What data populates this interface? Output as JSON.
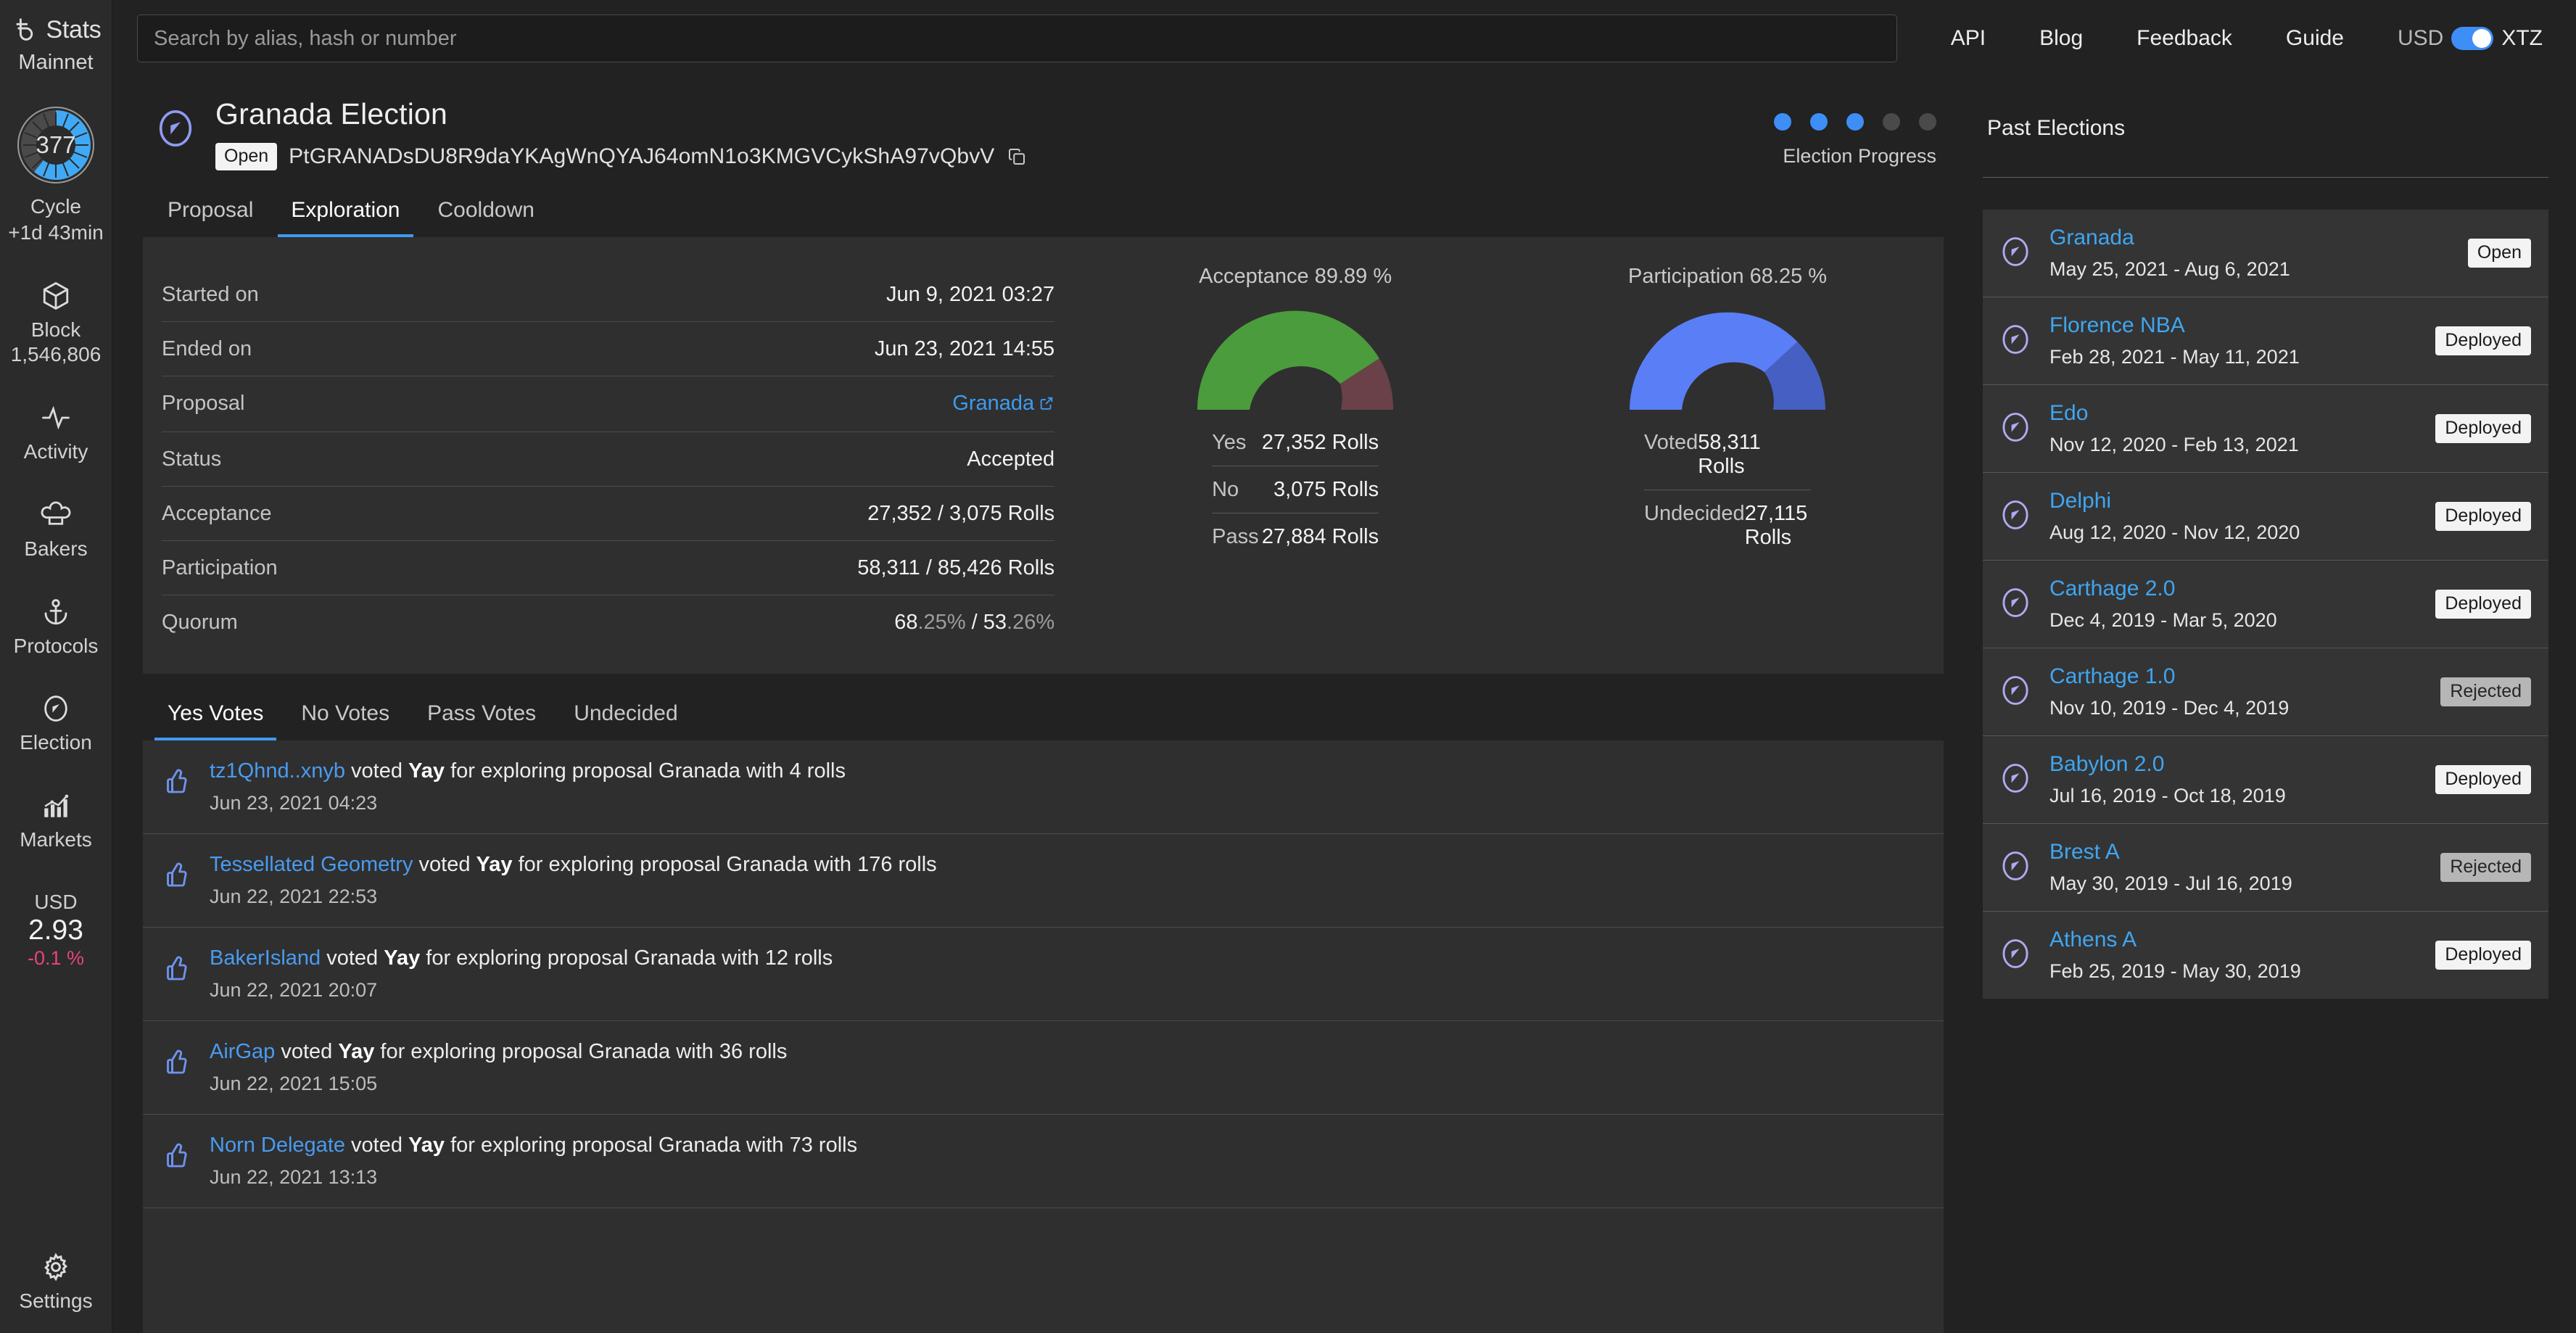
{
  "sidebar": {
    "brand": "Stats",
    "network": "Mainnet",
    "cycle": {
      "number": "377",
      "label": "Cycle",
      "eta": "+1d 43min"
    },
    "items": [
      {
        "icon": "cube-icon",
        "label": "Block",
        "sub": "1,546,806"
      },
      {
        "icon": "activity-icon",
        "label": "Activity",
        "sub": ""
      },
      {
        "icon": "chef-hat-icon",
        "label": "Bakers",
        "sub": ""
      },
      {
        "icon": "anchor-icon",
        "label": "Protocols",
        "sub": ""
      },
      {
        "icon": "compass-icon",
        "label": "Election",
        "sub": ""
      },
      {
        "icon": "bar-chart-icon",
        "label": "Markets",
        "sub": ""
      }
    ],
    "price": {
      "currency": "USD",
      "value": "2.93",
      "change": "-0.1 %"
    },
    "settings": {
      "icon": "gear-icon",
      "label": "Settings"
    }
  },
  "topbar": {
    "search_placeholder": "Search by alias, hash or number",
    "search_value": "",
    "links": [
      "API",
      "Blog",
      "Feedback",
      "Guide"
    ],
    "currency_toggle": {
      "left": "USD",
      "right": "XTZ",
      "on": true
    }
  },
  "election": {
    "title": "Granada Election",
    "status_badge": "Open",
    "hash": "PtGRANADsDU8R9daYKAgWnQYAJ64omN1o3KMGVCykShA97vQbvV",
    "progress": {
      "label": "Election Progress",
      "total": 5,
      "filled": 3
    },
    "tabs": [
      {
        "label": "Proposal",
        "active": false
      },
      {
        "label": "Exploration",
        "active": true
      },
      {
        "label": "Cooldown",
        "active": false
      }
    ],
    "details": [
      {
        "key": "Started on",
        "value": "Jun 9, 2021 03:27"
      },
      {
        "key": "Ended on",
        "value": "Jun 23, 2021 14:55"
      },
      {
        "key": "Proposal",
        "value": "Granada",
        "link": true
      },
      {
        "key": "Status",
        "value": "Accepted"
      },
      {
        "key": "Acceptance",
        "value": "27,352 / 3,075 Rolls"
      },
      {
        "key": "Participation",
        "value": "58,311 / 85,426 Rolls"
      },
      {
        "key": "Quorum",
        "value_main": "68",
        "value_dim": ".25%",
        "value_main2": " / 53",
        "value_dim2": ".26%"
      }
    ]
  },
  "chart_data": [
    {
      "type": "pie",
      "title": "Acceptance 89.89 %",
      "percent": 89.89,
      "categories": [
        "Yes",
        "No"
      ],
      "values": [
        27352,
        3075
      ],
      "colors": [
        "#4b9c3c",
        "#6a4149"
      ],
      "rows": [
        {
          "label": "Yes",
          "value": "27,352 Rolls"
        },
        {
          "label": "No",
          "value": "3,075 Rolls"
        },
        {
          "label": "Pass",
          "value": "27,884 Rolls"
        }
      ]
    },
    {
      "type": "pie",
      "title": "Participation 68.25 %",
      "percent": 68.25,
      "categories": [
        "Voted",
        "Undecided"
      ],
      "values": [
        58311,
        27115
      ],
      "colors": [
        "#5a7ef5",
        "#4560c2"
      ],
      "rows": [
        {
          "label": "Voted",
          "value": "58,311 Rolls"
        },
        {
          "label": "Undecided",
          "value": "27,115 Rolls"
        }
      ]
    }
  ],
  "votes": {
    "tabs": [
      {
        "label": "Yes Votes",
        "active": true
      },
      {
        "label": "No Votes",
        "active": false
      },
      {
        "label": "Pass Votes",
        "active": false
      },
      {
        "label": "Undecided",
        "active": false
      }
    ],
    "rows": [
      {
        "who": "tz1Qhnd..xnyb",
        "pre": " voted ",
        "vote": "Yay",
        "post": " for exploring proposal Granada with 4 rolls",
        "date": "Jun 23, 2021 04:23"
      },
      {
        "who": "Tessellated Geometry",
        "pre": " voted ",
        "vote": "Yay",
        "post": " for exploring proposal Granada with 176 rolls",
        "date": "Jun 22, 2021 22:53"
      },
      {
        "who": "BakerIsland",
        "pre": " voted ",
        "vote": "Yay",
        "post": " for exploring proposal Granada with 12 rolls",
        "date": "Jun 22, 2021 20:07"
      },
      {
        "who": "AirGap",
        "pre": " voted ",
        "vote": "Yay",
        "post": " for exploring proposal Granada with 36 rolls",
        "date": "Jun 22, 2021 15:05"
      },
      {
        "who": "Norn Delegate",
        "pre": " voted ",
        "vote": "Yay",
        "post": " for exploring proposal Granada with 73 rolls",
        "date": "Jun 22, 2021 13:13"
      }
    ]
  },
  "past_elections": {
    "title": "Past Elections",
    "rows": [
      {
        "name": "Granada",
        "dates": "May 25, 2021 - Aug 6, 2021",
        "badge": "Open",
        "rejected": false
      },
      {
        "name": "Florence NBA",
        "dates": "Feb 28, 2021 - May 11, 2021",
        "badge": "Deployed",
        "rejected": false
      },
      {
        "name": "Edo",
        "dates": "Nov 12, 2020 - Feb 13, 2021",
        "badge": "Deployed",
        "rejected": false
      },
      {
        "name": "Delphi",
        "dates": "Aug 12, 2020 - Nov 12, 2020",
        "badge": "Deployed",
        "rejected": false
      },
      {
        "name": "Carthage 2.0",
        "dates": "Dec 4, 2019 - Mar 5, 2020",
        "badge": "Deployed",
        "rejected": false
      },
      {
        "name": "Carthage 1.0",
        "dates": "Nov 10, 2019 - Dec 4, 2019",
        "badge": "Rejected",
        "rejected": true
      },
      {
        "name": "Babylon 2.0",
        "dates": "Jul 16, 2019 - Oct 18, 2019",
        "badge": "Deployed",
        "rejected": false
      },
      {
        "name": "Brest A",
        "dates": "May 30, 2019 - Jul 16, 2019",
        "badge": "Rejected",
        "rejected": true
      },
      {
        "name": "Athens A",
        "dates": "Feb 25, 2019 - May 30, 2019",
        "badge": "Deployed",
        "rejected": false
      }
    ]
  },
  "colors": {
    "accent_blue": "#3e8ef7",
    "link_blue": "#3fa6f2",
    "periwinkle": "#b0aaf0",
    "green": "#4b9c3c",
    "maroon": "#6a4149",
    "neg_pink": "#e8447c"
  }
}
